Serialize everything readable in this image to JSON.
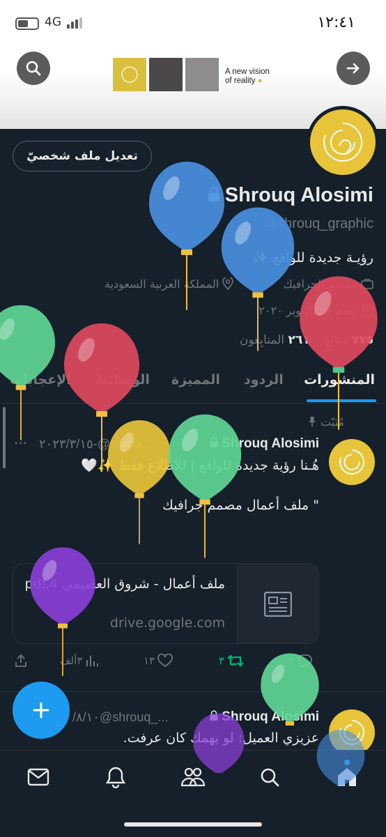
{
  "status": {
    "time": "١٢:٤١",
    "network": "4G"
  },
  "banner": {
    "tagline_line1": "A new vision",
    "tagline_line2": "of reality",
    "swatches": [
      "#d9bf3b",
      "#4a4848",
      "#8e8c8c"
    ]
  },
  "profile": {
    "edit_button": "تعديل ملف شخصيّ",
    "name": "Shrouq Alosimi",
    "handle": "@shrouq_graphic",
    "bio": "رؤيـة جديدة للواقع ✨",
    "category": "مصمم الجرافيك",
    "location": "المملكة العربية السعودية",
    "joined": "انضم في أكتوبر ٢٠٢٠",
    "following_count": "٧٧٥",
    "following_label": "متابَع",
    "followers_count": "٢٦١",
    "followers_label": "المتابِعون"
  },
  "tabs": [
    "المنشورات",
    "الردود",
    "المميزة",
    "الوسائط",
    "الإعجابات"
  ],
  "pinned_label": "مُثبّت",
  "tweet1": {
    "name": "Shrouq Alosimi",
    "handle": "@shrou...",
    "date": "٢٠٢٣/٣/١٥",
    "more": "···",
    "text_line1": "هُـنا رؤية جديدة للواقع | للاطلاع فقط ✨🤍",
    "text_line2": "\" ملف أعمال مصمم جرافيك",
    "card_title": "ملف أعمال - شروق العصيمي pdf.4",
    "card_domain": "drive.google.com",
    "replies": "٢",
    "retweets": "٣",
    "likes": "١٣",
    "views": "٣ألف"
  },
  "tweet2": {
    "name": "Shrouq Alosimi",
    "handle": "@shrouq_...",
    "date": "/٨/١٠",
    "text": "عزيزي العميل: لو يهمك كان عرفت."
  },
  "colors": {
    "accent": "#1d9bf0",
    "background": "#15202b",
    "retweet": "#00ba7c",
    "avatar": "#e8c43a"
  },
  "icons": [
    "search-icon",
    "forward-arrow-icon",
    "lock-icon",
    "briefcase-icon",
    "location-icon",
    "calendar-icon",
    "pin-icon",
    "reply-icon",
    "retweet-icon",
    "like-icon",
    "views-icon",
    "share-icon",
    "plus-icon",
    "mail-icon",
    "bell-icon",
    "communities-icon",
    "home-icon"
  ]
}
